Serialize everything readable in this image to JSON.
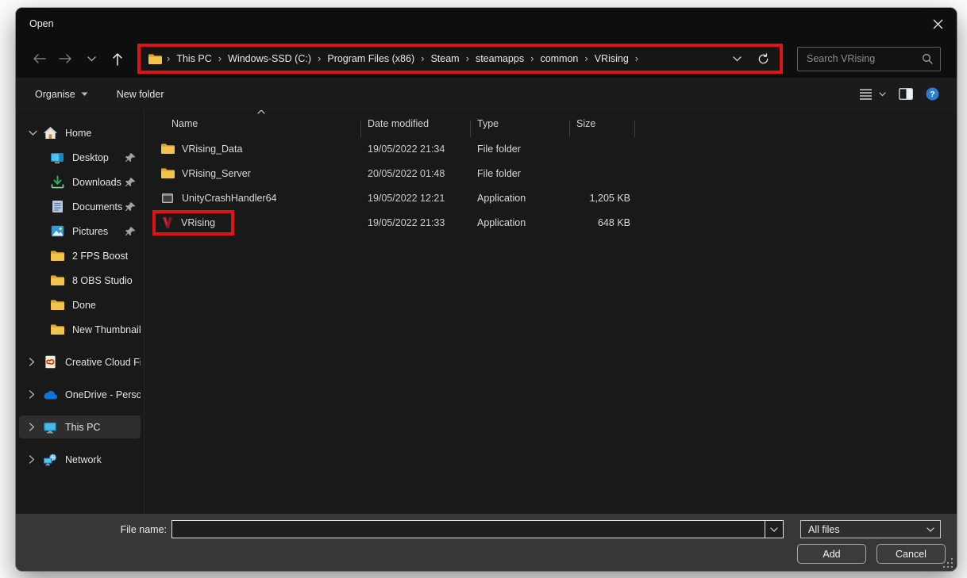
{
  "window": {
    "title": "Open"
  },
  "nav": {
    "breadcrumb": [
      "This PC",
      "Windows-SSD (C:)",
      "Program Files (x86)",
      "Steam",
      "steamapps",
      "common",
      "VRising"
    ],
    "search_placeholder": "Search VRising"
  },
  "commandbar": {
    "organise_label": "Organise",
    "new_folder_label": "New folder"
  },
  "sidebar": {
    "items": [
      {
        "label": "Home",
        "icon": "home-icon",
        "expander": "down",
        "pinned": false,
        "selected": false,
        "child": false,
        "gap": false
      },
      {
        "label": "Desktop",
        "icon": "desktop-icon",
        "expander": null,
        "pinned": true,
        "selected": false,
        "child": true,
        "gap": false
      },
      {
        "label": "Downloads",
        "icon": "downloads-icon",
        "expander": null,
        "pinned": true,
        "selected": false,
        "child": true,
        "gap": false
      },
      {
        "label": "Documents",
        "icon": "documents-icon",
        "expander": null,
        "pinned": true,
        "selected": false,
        "child": true,
        "gap": false
      },
      {
        "label": "Pictures",
        "icon": "pictures-icon",
        "expander": null,
        "pinned": true,
        "selected": false,
        "child": true,
        "gap": false
      },
      {
        "label": "2 FPS Boost",
        "icon": "folder-icon",
        "expander": null,
        "pinned": false,
        "selected": false,
        "child": true,
        "gap": false
      },
      {
        "label": "8 OBS Studio",
        "icon": "folder-icon",
        "expander": null,
        "pinned": false,
        "selected": false,
        "child": true,
        "gap": false
      },
      {
        "label": "Done",
        "icon": "folder-icon",
        "expander": null,
        "pinned": false,
        "selected": false,
        "child": true,
        "gap": false
      },
      {
        "label": "New Thumbnails",
        "icon": "folder-icon",
        "expander": null,
        "pinned": false,
        "selected": false,
        "child": true,
        "gap": false
      },
      {
        "label": "Creative Cloud Files",
        "icon": "creative-cloud-icon",
        "expander": "right",
        "pinned": false,
        "selected": false,
        "child": false,
        "gap": true
      },
      {
        "label": "OneDrive - Personal",
        "icon": "onedrive-icon",
        "expander": "right",
        "pinned": false,
        "selected": false,
        "child": false,
        "gap": true
      },
      {
        "label": "This PC",
        "icon": "this-pc-icon",
        "expander": "right",
        "pinned": false,
        "selected": true,
        "child": false,
        "gap": true
      },
      {
        "label": "Network",
        "icon": "network-icon",
        "expander": "right",
        "pinned": false,
        "selected": false,
        "child": false,
        "gap": true
      }
    ]
  },
  "filelist": {
    "columns": [
      "Name",
      "Date modified",
      "Type",
      "Size"
    ],
    "sorted_by": "Name",
    "rows": [
      {
        "name": "VRising_Data",
        "icon": "folder-icon",
        "date_modified": "19/05/2022 21:34",
        "type": "File folder",
        "size": "",
        "annotated": false
      },
      {
        "name": "VRising_Server",
        "icon": "folder-icon",
        "date_modified": "20/05/2022 01:48",
        "type": "File folder",
        "size": "",
        "annotated": false
      },
      {
        "name": "UnityCrashHandler64",
        "icon": "application-icon",
        "date_modified": "19/05/2022 12:21",
        "type": "Application",
        "size": "1,205 KB",
        "annotated": false
      },
      {
        "name": "VRising",
        "icon": "vrising-icon",
        "date_modified": "19/05/2022 21:33",
        "type": "Application",
        "size": "648 KB",
        "annotated": true
      }
    ]
  },
  "footer": {
    "file_name_label": "File name:",
    "file_name_value": "",
    "file_type_value": "All files",
    "add_label": "Add",
    "cancel_label": "Cancel"
  },
  "colors": {
    "annotation_red": "#e01212",
    "folder_yellow": "#f2c44c",
    "help_blue": "#2c7fd0",
    "selection_grey": "#2e2e2e",
    "footer_grey": "#373737"
  }
}
